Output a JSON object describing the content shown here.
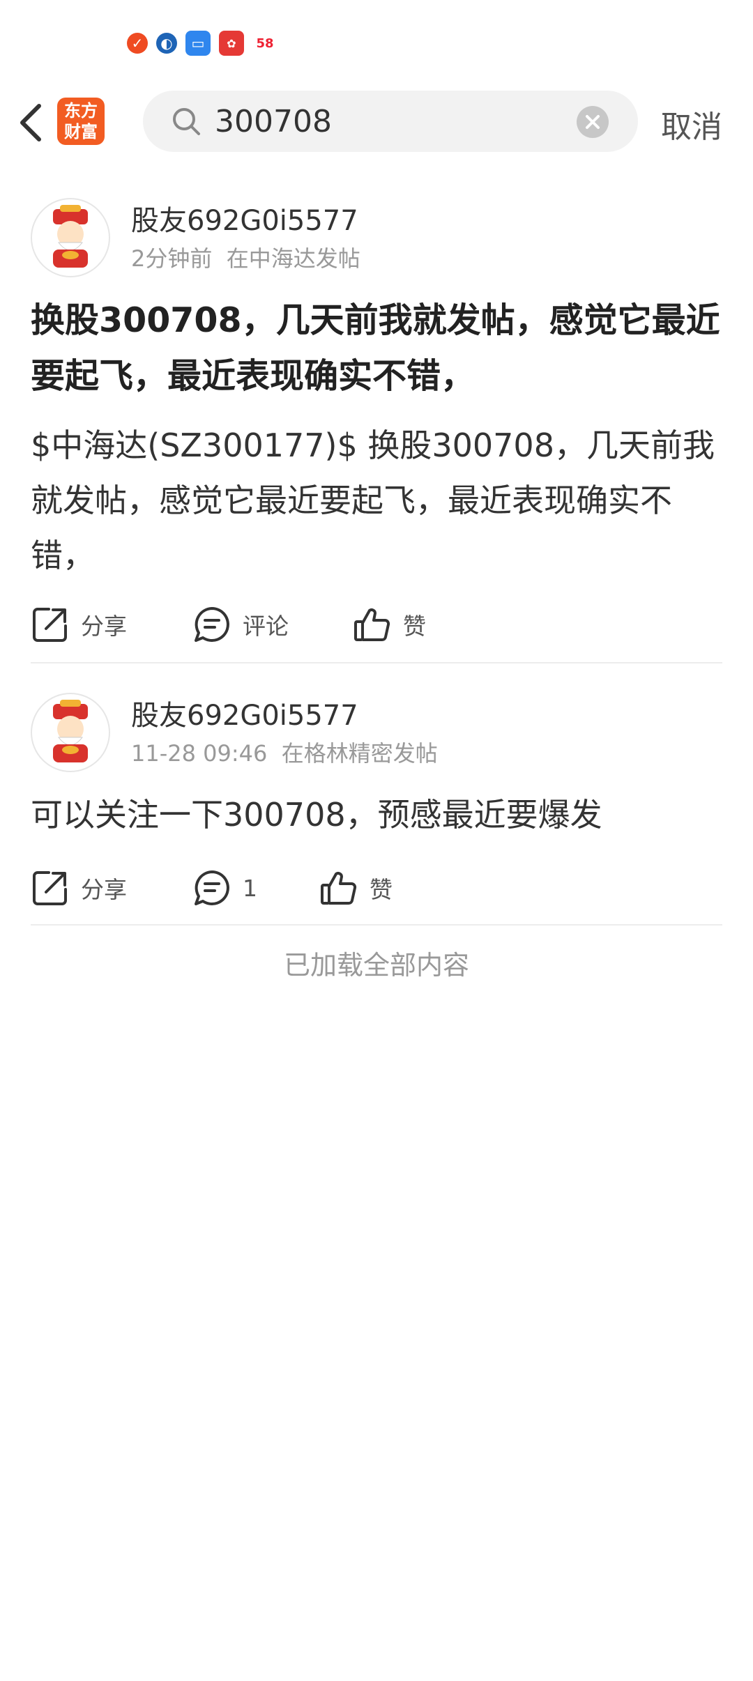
{
  "status_bar": {
    "notification_icons": [
      "app-icon",
      "bank-icon",
      "files-icon",
      "news-icon",
      "58-app-icon"
    ],
    "n58_label": "58"
  },
  "header": {
    "logo_line1": "东方",
    "logo_line2": "财富",
    "search": {
      "value": "300708"
    },
    "cancel_label": "取消"
  },
  "posts": [
    {
      "username": "股友692G0i5577",
      "time": "2分钟前",
      "location": "在中海达发帖",
      "title": "换股300708，几天前我就发帖，感觉它最近要起飞，最近表现确实不错，",
      "body": "$中海达(SZ300177)$ 换股300708，几天前我就发帖，感觉它最近要起飞，最近表现确实不错，",
      "share_label": "分享",
      "comment_label": "评论",
      "like_label": "赞"
    },
    {
      "username": "股友692G0i5577",
      "time": "11-28 09:46",
      "location": "在格林精密发帖",
      "body": "可以关注一下300708，预感最近要爆发",
      "share_label": "分享",
      "comment_label": "1",
      "like_label": "赞"
    }
  ],
  "footer_text": "已加载全部内容",
  "colors": {
    "brand": "#f25c22",
    "muted": "#999999",
    "search_bg": "#f2f2f2"
  }
}
